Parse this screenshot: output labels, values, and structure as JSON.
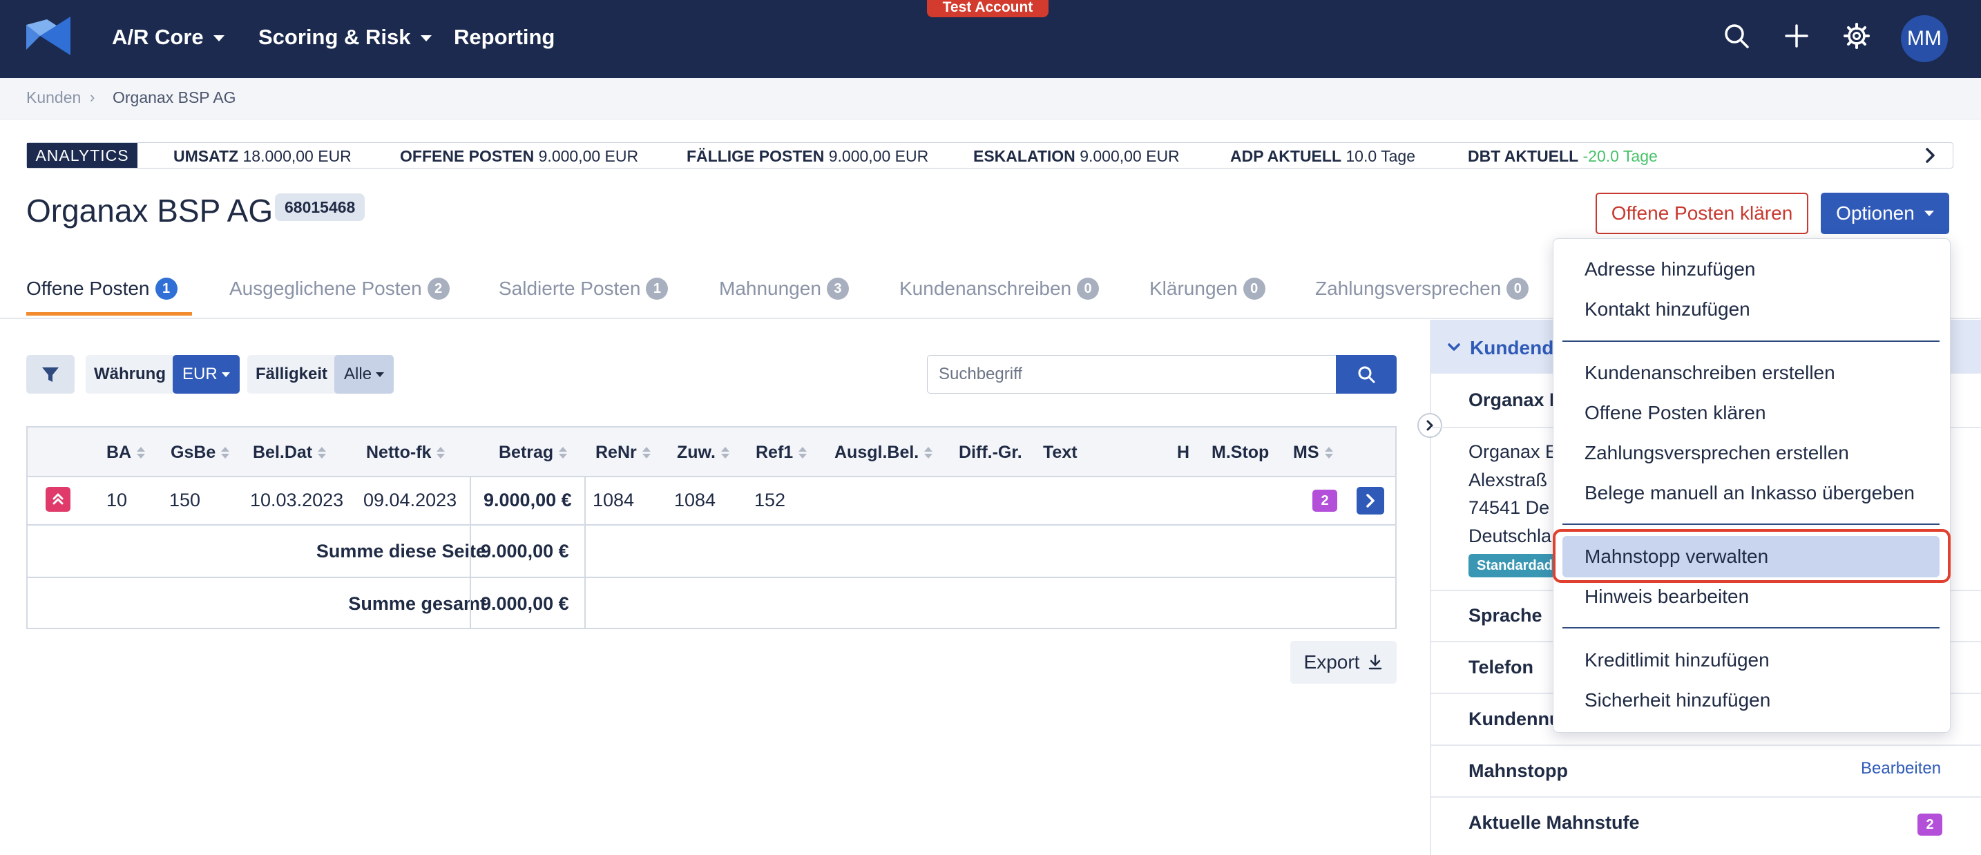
{
  "nav": {
    "items": [
      {
        "label": "A/R Core",
        "has_caret": true
      },
      {
        "label": "Scoring & Risk",
        "has_caret": true
      },
      {
        "label": "Reporting",
        "has_caret": false
      }
    ],
    "test_badge": "Test Account",
    "icons": [
      "search-icon",
      "plus-icon",
      "gear-icon"
    ],
    "avatar": "MM",
    "brand_color": "#1b2a4e"
  },
  "breadcrumb": [
    "Kunden",
    "Organax BSP AG"
  ],
  "analytics": {
    "tag": "ANALYTICS",
    "items": [
      {
        "label": "UMSATZ",
        "value": "18.000,00 EUR"
      },
      {
        "label": "OFFENE POSTEN",
        "value": "9.000,00 EUR"
      },
      {
        "label": "FÄLLIGE POSTEN",
        "value": "9.000,00 EUR"
      },
      {
        "label": "ESKALATION",
        "value": "9.000,00 EUR"
      },
      {
        "label": "ADP AKTUELL",
        "value": "10.0 Tage"
      },
      {
        "label": "DBT AKTUELL",
        "value": "-20.0 Tage",
        "value_color": "#47c26a"
      }
    ]
  },
  "header": {
    "title": "Organax BSP AG",
    "id_badge": "68015468",
    "btn_clear": "Offene Posten klären",
    "btn_options": "Optionen"
  },
  "tabs": [
    {
      "label": "Offene Posten",
      "count": "1",
      "active": true
    },
    {
      "label": "Ausgeglichene Posten",
      "count": "2"
    },
    {
      "label": "Saldierte Posten",
      "count": "1"
    },
    {
      "label": "Mahnungen",
      "count": "3"
    },
    {
      "label": "Kundenanschreiben",
      "count": "0"
    },
    {
      "label": "Klärungen",
      "count": "0"
    },
    {
      "label": "Zahlungsversprechen",
      "count": "0"
    }
  ],
  "filters": {
    "currency_label": "Währung",
    "currency_value": "EUR",
    "due_label": "Fälligkeit",
    "due_value": "Alle",
    "search_placeholder": "Suchbegriff"
  },
  "table": {
    "columns": [
      "BA",
      "GsBe",
      "Bel.Dat",
      "Netto-fk",
      "Betrag",
      "ReNr",
      "Zuw.",
      "Ref1",
      "Ausgl.Bel.",
      "Diff.-Gr.",
      "Text",
      "H",
      "M.Stop",
      "MS"
    ],
    "rows": [
      {
        "ba": "10",
        "gsbe": "150",
        "beldat": "10.03.2023",
        "netto": "09.04.2023",
        "betrag": "9.000,00 €",
        "renr": "1084",
        "zuw": "1084",
        "ref1": "152",
        "ms": "2"
      }
    ],
    "sum_page_label": "Summe diese Seite",
    "sum_page_value": "9.000,00 €",
    "sum_total_label": "Summe gesamt",
    "sum_total_value": "9.000,00 €"
  },
  "export_label": "Export",
  "panel": {
    "title": "Kundend",
    "name": "Organax E",
    "address": [
      "Organax E",
      "Alexstraß",
      "74541 De",
      "Deutschla"
    ],
    "badge": "Standardad",
    "rows": [
      {
        "label": "Sprache"
      },
      {
        "label": "Telefon"
      },
      {
        "label": "Kundennu"
      },
      {
        "label": "Mahnstopp",
        "action": "Bearbeiten"
      },
      {
        "label": "Aktuelle Mahnstufe",
        "badge": "2"
      }
    ]
  },
  "dropdown": {
    "groups": [
      [
        "Adresse hinzufügen",
        "Kontakt hinzufügen"
      ],
      [
        "Kundenanschreiben erstellen",
        "Offene Posten klären",
        "Zahlungsversprechen erstellen",
        "Belege manuell an Inkasso übergeben"
      ],
      [
        "Mahnstopp verwalten",
        "Hinweis bearbeiten"
      ],
      [
        "Kreditlimit hinzufügen",
        "Sicherheit hinzufügen"
      ]
    ],
    "highlighted": "Mahnstopp verwalten"
  }
}
